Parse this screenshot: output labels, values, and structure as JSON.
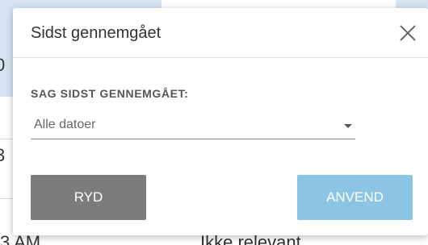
{
  "background": {
    "row_fragments": [
      "0",
      "3",
      "3 AM"
    ],
    "cell_fragment": "Ikke relevant"
  },
  "dialog": {
    "title": "Sidst gennemgået",
    "close_icon": "close-icon",
    "section_label": "SAG SIDST GENNEMGÅET:",
    "select": {
      "value": "Alle datoer",
      "icon": "caret-down-icon"
    },
    "buttons": {
      "clear_label": "RYD",
      "apply_label": "ANVEND"
    }
  },
  "colors": {
    "clear_button": "#7c7c7c",
    "apply_button": "#8cc5e3",
    "background_cell": "#d7e4f2"
  }
}
